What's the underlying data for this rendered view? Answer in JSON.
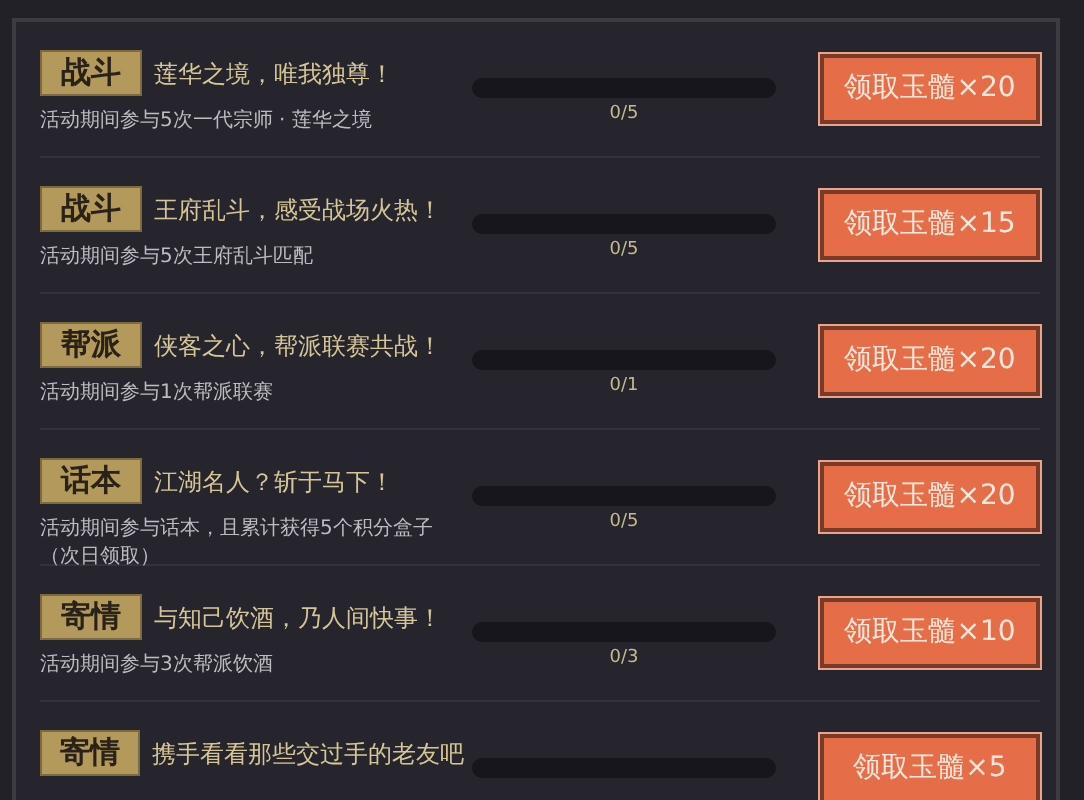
{
  "tasks": [
    {
      "tag": "战斗",
      "title": "莲华之境，唯我独尊！",
      "description": "活动期间参与5次一代宗师 · 莲华之境",
      "level": 0,
      "progress": "0/5",
      "reward": "领取玉髓×20"
    },
    {
      "tag": "战斗",
      "title": "王府乱斗，感受战场火热！",
      "description": "活动期间参与5次王府乱斗匹配",
      "level": 0,
      "progress": "0/5",
      "reward": "领取玉髓×15"
    },
    {
      "tag": "帮派",
      "title": "侠客之心，帮派联赛共战！",
      "description": "活动期间参与1次帮派联赛",
      "level": 0,
      "progress": "0/1",
      "reward": "领取玉髓×20"
    },
    {
      "tag": "话本",
      "title": "江湖名人？斩于马下！",
      "description": "活动期间参与话本，且累计获得5个积分盒子（次日领取）",
      "level": 0,
      "progress": "0/5",
      "reward": "领取玉髓×20"
    },
    {
      "tag": "寄情",
      "title": "与知己饮酒，乃人间快事！",
      "description": "活动期间参与3次帮派饮酒",
      "level": 0,
      "progress": "0/3",
      "reward": "领取玉髓×10"
    },
    {
      "tag": "寄情",
      "title": "携手看看那些交过手的老友吧",
      "level": 0,
      "reward": "领取玉髓×5"
    }
  ]
}
